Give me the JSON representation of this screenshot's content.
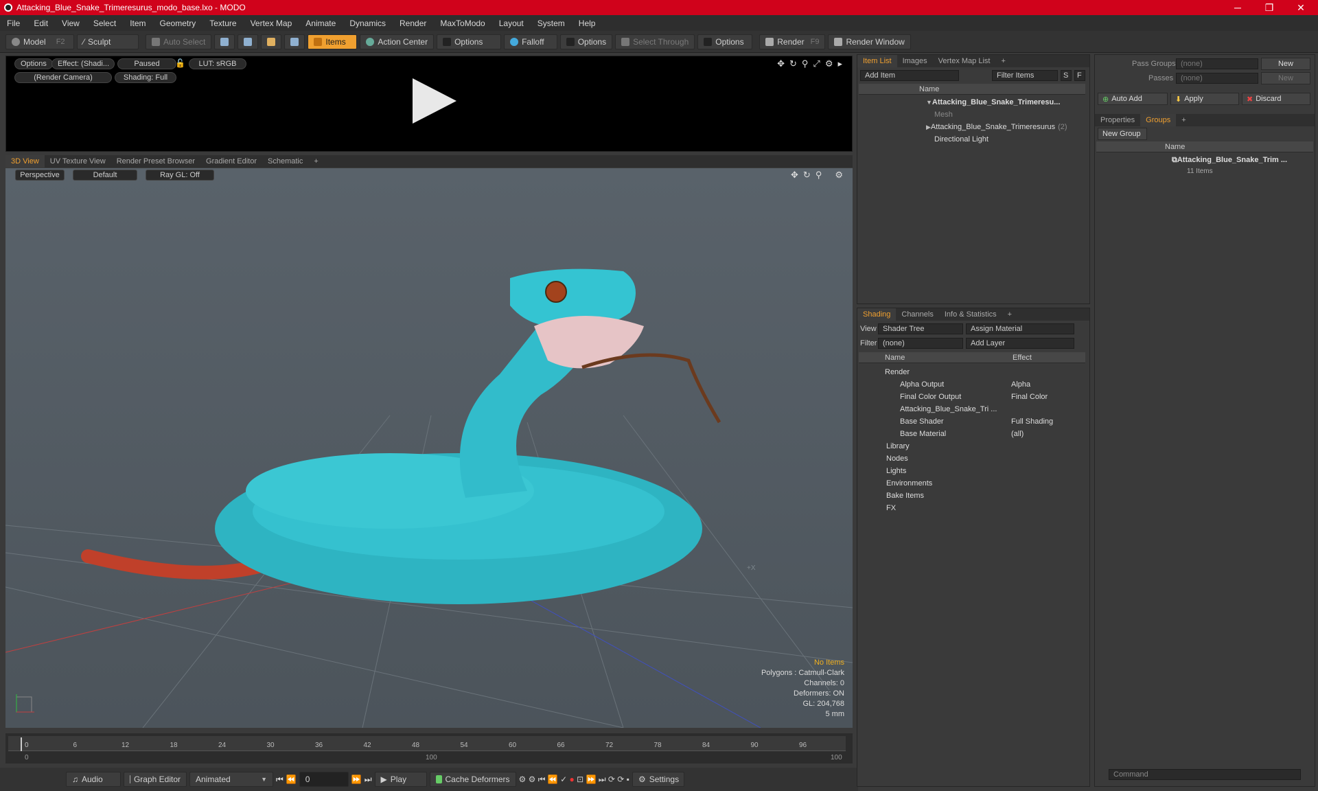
{
  "window": {
    "title": "Attacking_Blue_Snake_Trimeresurus_modo_base.lxo - MODO",
    "minimize": "─",
    "restore": "❐",
    "close": "✕"
  },
  "menu": [
    "File",
    "Edit",
    "View",
    "Select",
    "Item",
    "Geometry",
    "Texture",
    "Vertex Map",
    "Animate",
    "Dynamics",
    "Render",
    "MaxToModo",
    "Layout",
    "System",
    "Help"
  ],
  "toolbar": {
    "model": "Model",
    "model_key": "F2",
    "sculpt": "Sculpt",
    "auto_select": "Auto Select",
    "items": "Items",
    "action_center": "Action Center",
    "options1": "Options",
    "falloff": "Falloff",
    "options2": "Options",
    "select_through": "Select Through",
    "options3": "Options",
    "render": "Render",
    "render_key": "F9",
    "render_window": "Render Window"
  },
  "preview": {
    "options": "Options",
    "effect": "Effect: (Shadi...",
    "paused": "Paused",
    "lut": "LUT: sRGB",
    "camera": "(Render Camera)",
    "shading": "Shading: Full"
  },
  "view_tabs": [
    "3D View",
    "UV Texture View",
    "Render Preset Browser",
    "Gradient Editor",
    "Schematic"
  ],
  "viewport": {
    "projection": "Perspective",
    "style": "Default",
    "raygl": "Ray GL: Off",
    "hud": {
      "no_items": "No Items",
      "polygons": "Polygons : Catmull-Clark",
      "channels": "Channels: 0",
      "deformers": "Deformers: ON",
      "gl": "GL: 204,768",
      "unit": "5 mm"
    }
  },
  "timeline": {
    "ticks": [
      "0",
      "6",
      "12",
      "18",
      "24",
      "30",
      "36",
      "42",
      "48",
      "54",
      "60",
      "66",
      "72",
      "78",
      "84",
      "90",
      "96"
    ],
    "lower_ticks": [
      "0",
      "100",
      "100"
    ]
  },
  "bottom": {
    "audio": "Audio",
    "graph_editor": "Graph Editor",
    "animated": "Animated",
    "frame": "0",
    "play": "Play",
    "cache": "Cache Deformers",
    "settings": "Settings"
  },
  "items_panel": {
    "tabs": [
      "Item List",
      "Images",
      "Vertex Map List"
    ],
    "add_item": "Add Item",
    "filter_items": "Filter Items",
    "s": "S",
    "f": "F",
    "col_name": "Name",
    "rows": [
      "Attacking_Blue_Snake_Trimeresu...",
      "Mesh",
      "Attacking_Blue_Snake_Trimeresurus",
      "Directional Light"
    ],
    "row2_count": "(2)"
  },
  "shading_panel": {
    "tabs": [
      "Shading",
      "Channels",
      "Info & Statistics"
    ],
    "view_label": "View",
    "view_value": "Shader Tree",
    "assign": "Assign Material",
    "filter_label": "Filter",
    "filter_value": "(none)",
    "add_layer": "Add Layer",
    "col_name": "Name",
    "col_effect": "Effect",
    "rows": [
      {
        "name": "Render",
        "effect": ""
      },
      {
        "name": "Alpha Output",
        "effect": "Alpha"
      },
      {
        "name": "Final Color Output",
        "effect": "Final Color"
      },
      {
        "name": "Attacking_Blue_Snake_Tri ...",
        "effect": ""
      },
      {
        "name": "Base Shader",
        "effect": "Full Shading"
      },
      {
        "name": "Base Material",
        "effect": "(all)"
      },
      {
        "name": "Library",
        "effect": ""
      },
      {
        "name": "Nodes",
        "effect": ""
      },
      {
        "name": "Lights",
        "effect": ""
      },
      {
        "name": "Environments",
        "effect": ""
      },
      {
        "name": "Bake Items",
        "effect": ""
      },
      {
        "name": "FX",
        "effect": ""
      }
    ]
  },
  "groups_panel": {
    "pass_groups": "Pass Groups",
    "passes": "Passes",
    "none1": "(none)",
    "none2": "(none)",
    "new1": "New",
    "new2": "New",
    "auto_add": "Auto Add",
    "apply": "Apply",
    "discard": "Discard",
    "tabs": [
      "Properties",
      "Groups"
    ],
    "new_group": "New Group",
    "col_name": "Name",
    "group_name": "Attacking_Blue_Snake_Trim ...",
    "group_count": "11 Items"
  },
  "command": {
    "placeholder": "Command"
  }
}
